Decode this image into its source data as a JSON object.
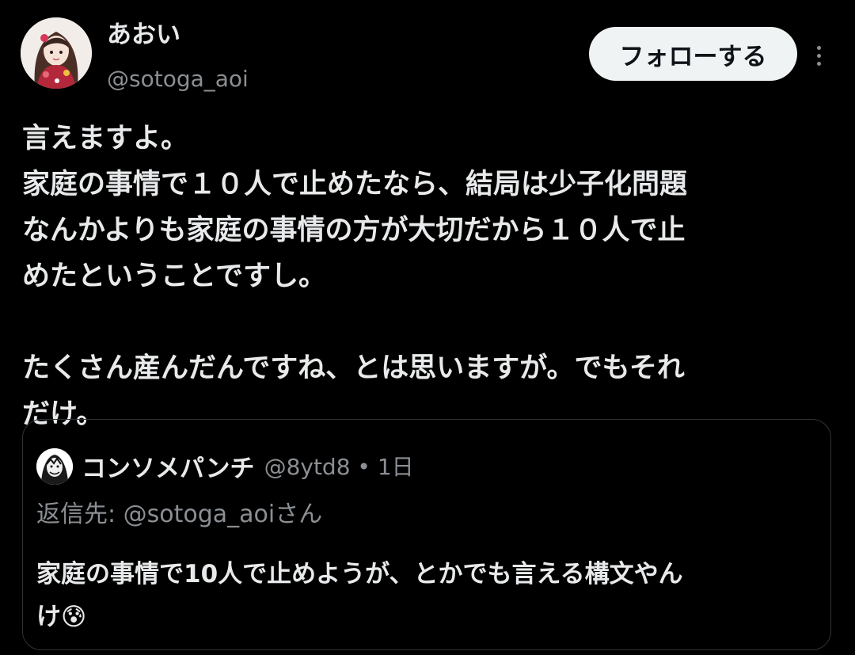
{
  "author": {
    "display_name": "あおい",
    "handle": "@sotoga_aoi",
    "avatar_icon": "user-avatar-illustration"
  },
  "actions": {
    "follow_label": "フォローする",
    "more_icon": "more-vertical-icon"
  },
  "tweet": {
    "lines": [
      "言えますよ。",
      "家庭の事情で１０人で止めたなら、結局は少子化問題",
      "なんかよりも家庭の事情の方が大切だから１０人で止",
      "めたということですし。",
      "",
      "たくさん産んだんですね、とは思いますが。でもそれ",
      "だけ。"
    ]
  },
  "quoted_tweet": {
    "display_name": "コンソメパンチ",
    "meta": "@8ytd8 • 1日",
    "reply_to": "返信先: @sotoga_aoiさん",
    "lines": [
      "家庭の事情で10人で止めようが、とかでも言える構文やん",
      "け😰"
    ],
    "avatar_icon": "user-avatar-manga"
  },
  "colors": {
    "background": "#000000",
    "text_primary": "#e7e9ea",
    "text_secondary": "#8b8f93",
    "follow_button_bg": "#eff3f4",
    "border": "#2f3336"
  }
}
